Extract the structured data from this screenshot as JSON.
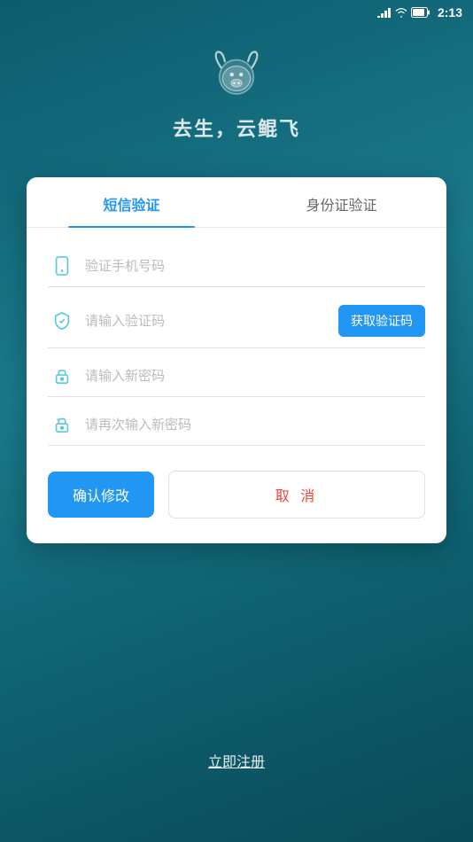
{
  "status_bar": {
    "time": "2:13",
    "icons": [
      "signal",
      "wifi",
      "battery"
    ]
  },
  "logo": {
    "text": "去生，云鲲飞"
  },
  "dialog": {
    "tabs": [
      {
        "id": "sms",
        "label": "短信验证",
        "active": true
      },
      {
        "id": "id",
        "label": "身份证验证",
        "active": false
      }
    ],
    "fields": [
      {
        "id": "phone",
        "icon": "phone-icon",
        "placeholder": "验证手机号码",
        "has_button": false
      },
      {
        "id": "verify-code",
        "icon": "shield-icon",
        "placeholder": "请输入验证码",
        "has_button": true,
        "button_label": "获取验证码"
      },
      {
        "id": "new-password",
        "icon": "lock-icon",
        "placeholder": "请输入新密码",
        "has_button": false
      },
      {
        "id": "confirm-password",
        "icon": "lock2-icon",
        "placeholder": "请再次输入新密码",
        "has_button": false
      }
    ],
    "confirm_button": "确认修改",
    "cancel_button": "取 消"
  },
  "register_link": "立即注册"
}
